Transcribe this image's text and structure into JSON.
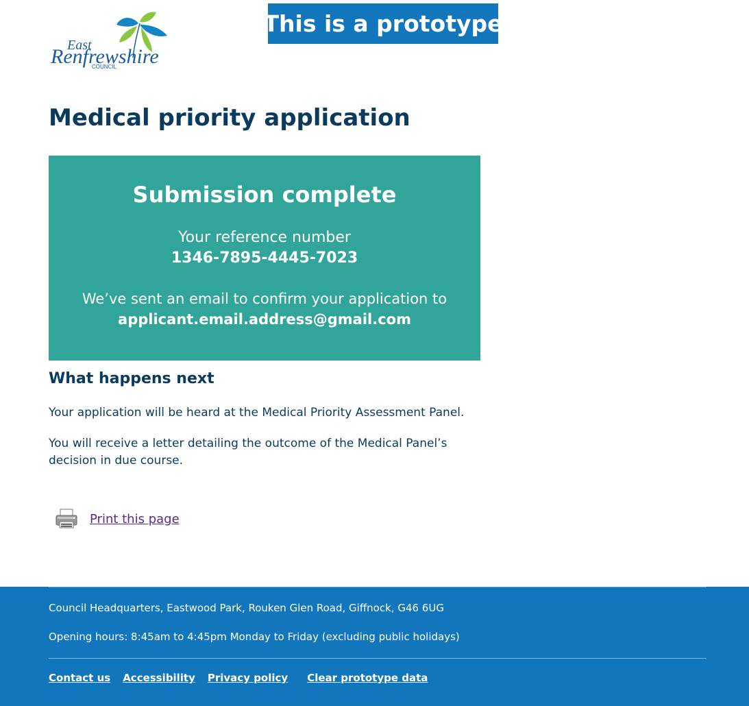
{
  "header": {
    "logo": {
      "line1": "East",
      "line2": "Renfrewshire",
      "line3": "COUNCIL",
      "colors": {
        "text": "#1a5d9e",
        "leaf_blue": "#1584c6",
        "leaf_green": "#8cc63f"
      }
    },
    "prototype_banner": "This is a prototype"
  },
  "page_title": "Medical priority application",
  "confirmation_panel": {
    "title": "Submission complete",
    "reference_label": "Your reference number",
    "reference_number": "1346-7895-4445-7023",
    "email_label": "We’ve sent an email to confirm your application to",
    "email_address": "applicant.email.address@gmail.com",
    "background_color": "#31a599"
  },
  "next_steps": {
    "heading": "What happens next",
    "paragraph1": "Your application will be heard at the Medical Priority Assessment Panel.",
    "paragraph2": "You will receive a letter detailing the outcome of the Medical Panel’s decision in due course."
  },
  "print": {
    "icon": "printer-icon",
    "link_label": "Print this page"
  },
  "footer": {
    "address": "Council Headquarters, Eastwood Park, Rouken Glen Road, Giffnock, G46 6UG",
    "hours": "Opening hours: 8:45am to 4:45pm Monday to Friday (excluding public holidays)",
    "links": {
      "contact": "Contact us",
      "accessibility": "Accessibility",
      "privacy": "Privacy policy",
      "clear": "Clear prototype data"
    },
    "background_color": "#1276bd"
  }
}
